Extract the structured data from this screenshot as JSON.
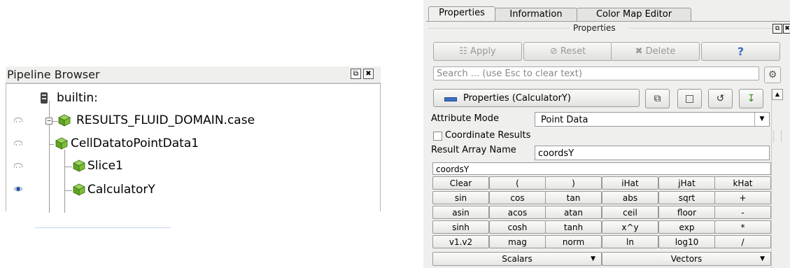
{
  "pipeline_browser": {
    "title": "Pipeline Browser",
    "items": [
      {
        "label": "builtin:"
      },
      {
        "label": "RESULTS_FLUID_DOMAIN.case"
      },
      {
        "label": "CellDatatoPointData1"
      },
      {
        "label": "Slice1"
      },
      {
        "label": "CalculatorY"
      }
    ]
  },
  "properties_panel": {
    "tabs": [
      {
        "label": "Properties"
      },
      {
        "label": "Information"
      },
      {
        "label": "Color Map Editor"
      }
    ],
    "title": "Properties",
    "buttons": {
      "apply": "Apply",
      "reset": "Reset",
      "delete": "Delete",
      "help": "?"
    },
    "search_placeholder": "Search ... (use Esc to clear text)",
    "section_label": "Properties (CalculatorY)",
    "attribute_mode_label": "Attribute Mode",
    "attribute_mode_value": "Point Data",
    "coordinate_results_label": "Coordinate Results",
    "result_array_name_label": "Result Array Name",
    "result_array_name_value": "coordsY",
    "expression": "coordsY",
    "calculator_keys": [
      [
        "Clear",
        "(",
        ")",
        "iHat",
        "jHat",
        "kHat"
      ],
      [
        "sin",
        "cos",
        "tan",
        "abs",
        "sqrt",
        "+"
      ],
      [
        "asin",
        "acos",
        "atan",
        "ceil",
        "floor",
        "-"
      ],
      [
        "sinh",
        "cosh",
        "tanh",
        "x^y",
        "exp",
        "*"
      ],
      [
        "v1.v2",
        "mag",
        "norm",
        "ln",
        "log10",
        "/"
      ]
    ],
    "dropdowns": [
      "Scalars",
      "Vectors"
    ]
  }
}
